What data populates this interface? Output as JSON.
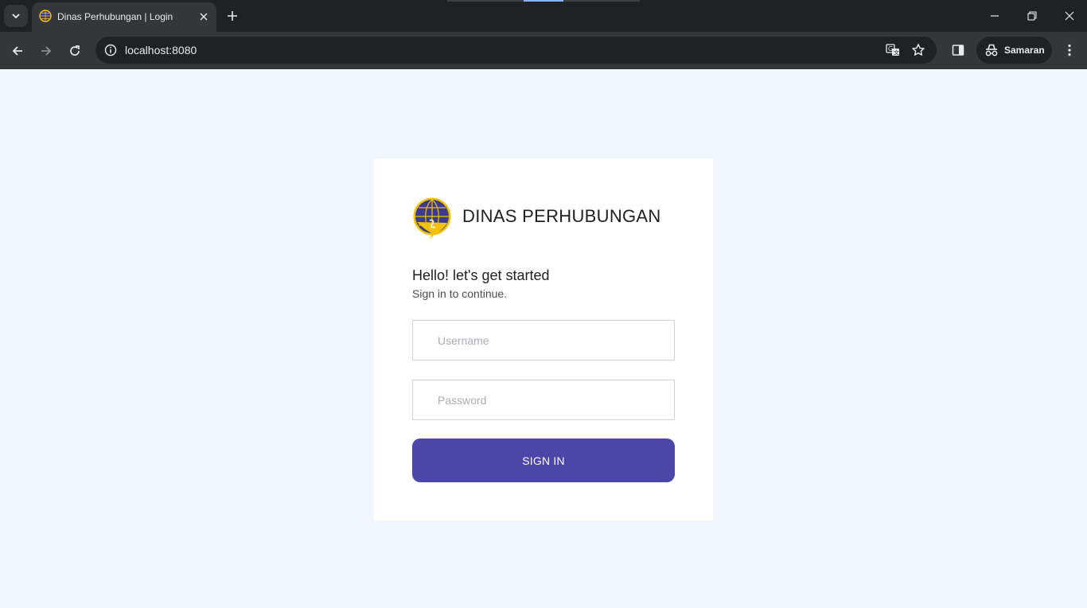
{
  "browser": {
    "tab_title": "Dinas Perhubungan | Login",
    "url": "localhost:8080",
    "profile_name": "Samaran",
    "accent_color": "#8ab4f8"
  },
  "login": {
    "brand_name": "DINAS PERHUBUNGAN",
    "greeting": "Hello! let's get started",
    "subtitle": "Sign in to continue.",
    "username_placeholder": "Username",
    "password_placeholder": "Password",
    "signin_label": "SIGN IN",
    "button_color": "#4b47a8",
    "background_color": "#f2f6ff"
  }
}
